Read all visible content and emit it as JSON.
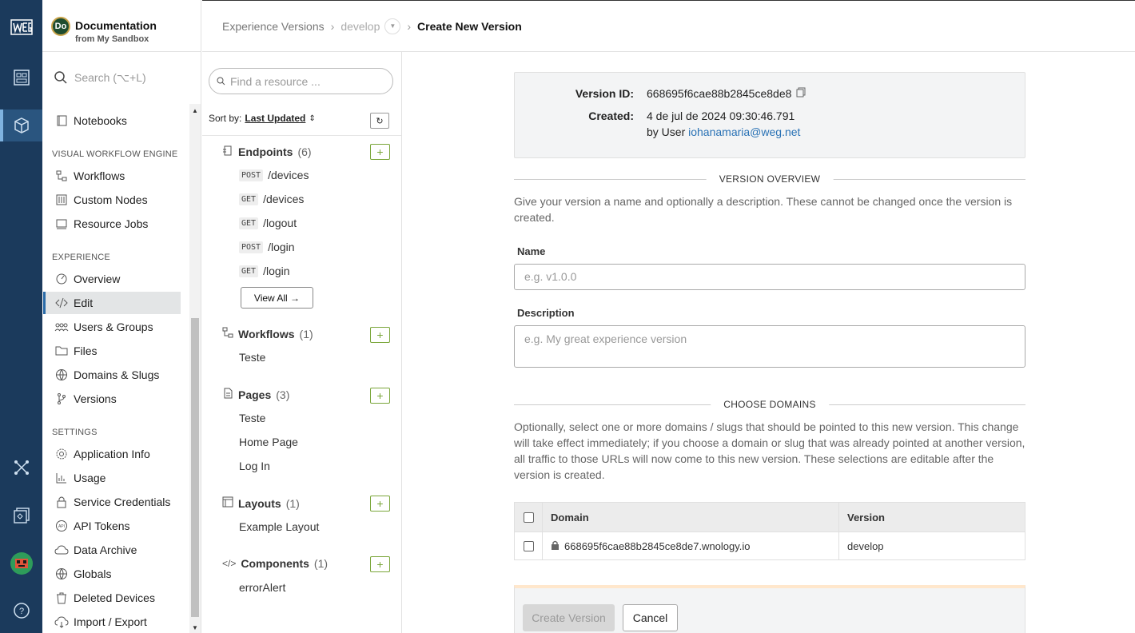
{
  "rail": {
    "brand": "weg-logo",
    "icons": [
      "dashboard-icon",
      "cube-icon",
      "network-icon",
      "devices-icon",
      "user-avatar",
      "help-icon"
    ]
  },
  "app": {
    "avatar_initials": "Do",
    "title": "Documentation",
    "subtitle": "from My Sandbox",
    "search_placeholder": "Search (⌥+L)"
  },
  "nav": {
    "top_item": "Notebooks",
    "sections": {
      "workflow_engine": "VISUAL WORKFLOW ENGINE",
      "experience": "EXPERIENCE",
      "settings": "SETTINGS"
    },
    "workflow_items": [
      "Workflows",
      "Custom Nodes",
      "Resource Jobs"
    ],
    "experience_items": [
      "Overview",
      "Edit",
      "Users & Groups",
      "Files",
      "Domains & Slugs",
      "Versions"
    ],
    "settings_items": [
      "Application Info",
      "Usage",
      "Service Credentials",
      "API Tokens",
      "Data Archive",
      "Globals",
      "Deleted Devices",
      "Import / Export"
    ],
    "selected": "Edit"
  },
  "breadcrumb": {
    "root": "Experience Versions",
    "branch": "develop",
    "current": "Create New Version"
  },
  "resources": {
    "find_placeholder": "Find a resource ...",
    "sort_label": "Sort by:",
    "sort_value": "Last Updated",
    "endpoints": {
      "title": "Endpoints",
      "count": "(6)",
      "items": [
        {
          "method": "POST",
          "path": "/devices"
        },
        {
          "method": "GET",
          "path": "/devices"
        },
        {
          "method": "GET",
          "path": "/logout"
        },
        {
          "method": "POST",
          "path": "/login"
        },
        {
          "method": "GET",
          "path": "/login"
        }
      ],
      "view_all": "View All →"
    },
    "workflows": {
      "title": "Workflows",
      "count": "(1)",
      "items": [
        "Teste"
      ]
    },
    "pages": {
      "title": "Pages",
      "count": "(3)",
      "items": [
        "Teste",
        "Home Page",
        "Log In"
      ]
    },
    "layouts": {
      "title": "Layouts",
      "count": "(1)",
      "items": [
        "Example Layout"
      ]
    },
    "components": {
      "title": "Components",
      "count": "(1)",
      "items": [
        "errorAlert"
      ]
    }
  },
  "form": {
    "version_id_label": "Version ID:",
    "version_id": "668695f6cae88b2845ce8de8",
    "created_label": "Created:",
    "created_date": "4 de jul de 2024 09:30:46.791",
    "created_by_prefix": "by User",
    "created_by_email": "iohanamaria@weg.net",
    "overview_heading": "VERSION OVERVIEW",
    "overview_text": "Give your version a name and optionally a description. These cannot be changed once the version is created.",
    "name_label": "Name",
    "name_placeholder": "e.g. v1.0.0",
    "description_label": "Description",
    "description_placeholder": "e.g. My great experience version",
    "domains_heading": "CHOOSE DOMAINS",
    "domains_text": "Optionally, select one or more domains / slugs that should be pointed to this new version. This change will take effect immediately; if you choose a domain or slug that was already pointed at another version, all traffic to those URLs will now come to this new version. These selections are editable after the version is created.",
    "table": {
      "col_domain": "Domain",
      "col_version": "Version",
      "rows": [
        {
          "domain": "668695f6cae88b2845ce8de7.wnology.io",
          "version": "develop"
        }
      ]
    },
    "create_button": "Create Version",
    "cancel_button": "Cancel"
  }
}
